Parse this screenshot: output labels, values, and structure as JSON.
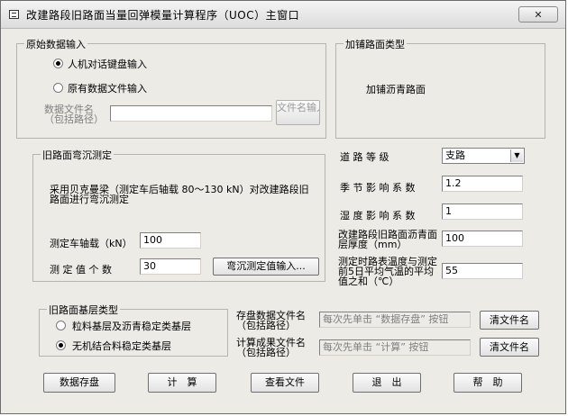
{
  "window": {
    "title": "改建路段旧路面当量回弹模量计算程序（UOC）主窗口",
    "close_label": "✕"
  },
  "input_group": {
    "title": "原始数据输入",
    "radio_manual": "人机对话键盘输入",
    "radio_file": "原有数据文件输入",
    "file_label": "数据文件名（包括路径）",
    "file_value": "",
    "file_button": "文件名输入..."
  },
  "overlay_group": {
    "title": "加铺路面类型",
    "value": "加铺沥青路面"
  },
  "deflection_group": {
    "title": "旧路面弯沉测定",
    "description": "采用贝克曼梁（测定车后轴载 80～130 kN）对改建路段旧路面进行弯沉测定",
    "axle_label": "测定车轴载（kN）",
    "axle_value": "100",
    "count_label": "测 定 值 个 数",
    "count_value": "30",
    "input_button": "弯沉测定值输入..."
  },
  "params": {
    "road_grade_label": "道 路 等 级",
    "road_grade_value": "支路",
    "season_label": "季 节 影 响 系 数",
    "season_value": "1.2",
    "humidity_label": "湿 度 影 响 系 数",
    "humidity_value": "1",
    "thickness_label": "改建路段旧路面沥青面层厚度（mm）",
    "thickness_value": "100",
    "temp_label": "测定时路表温度与测定前5日平均气温的平均值之和（℃）",
    "temp_value": "55"
  },
  "base_group": {
    "title": "旧路面基层类型",
    "radio_granular": "粒料基层及沥青稳定类基层",
    "radio_inorganic": "无机结合料稳定类基层"
  },
  "files": {
    "save_label": "存盘数据文件名（包括路径）",
    "save_value": "每次先单击 “数据存盘” 按钮",
    "result_label": "计算成果文件名（包括路径）",
    "result_value": "每次先单击 “计算” 按钮",
    "clear_label": "清文件名"
  },
  "buttons": {
    "save": "数据存盘",
    "calc": "计　算",
    "view": "查看文件",
    "exit": "退　出",
    "help": "帮　助"
  }
}
